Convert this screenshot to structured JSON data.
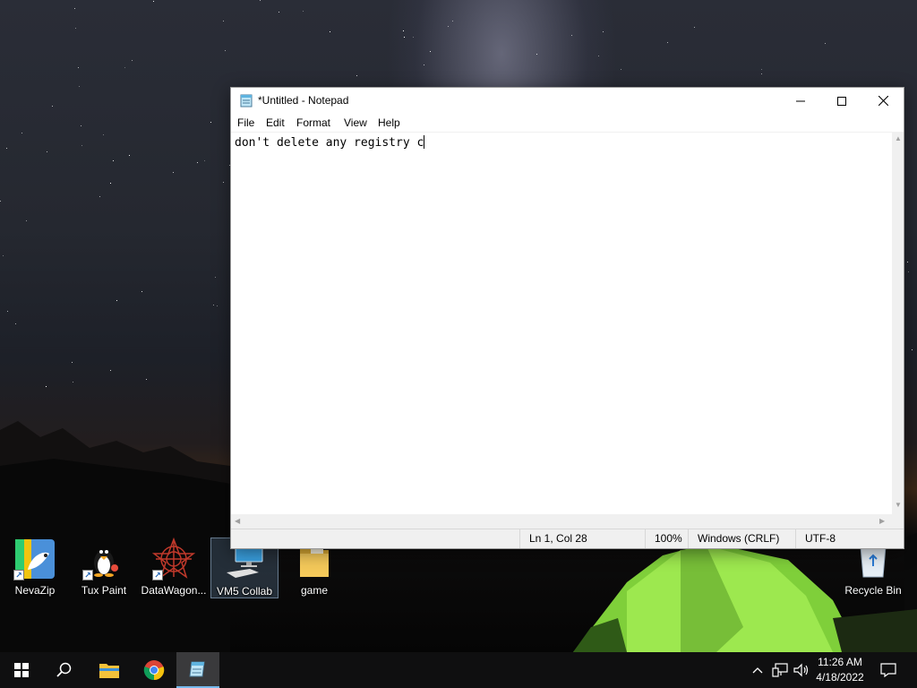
{
  "desktop": {
    "icons": [
      {
        "label": "NevaZip",
        "icon": "nevazip-icon"
      },
      {
        "label": "Tux Paint",
        "icon": "tux-paint-icon"
      },
      {
        "label": "DataWagon...",
        "icon": "datawagon-icon"
      },
      {
        "label": "VM5 Collab",
        "icon": "computer-icon"
      },
      {
        "label": "game",
        "icon": "folder-icon"
      },
      {
        "label": "Recycle Bin",
        "icon": "recycle-bin-icon"
      }
    ]
  },
  "notepad": {
    "title": "*Untitled - Notepad",
    "menu": [
      "File",
      "Edit",
      "Format",
      "View",
      "Help"
    ],
    "content": "don't delete any registry c",
    "status": {
      "position": "Ln 1, Col 28",
      "zoom": "100%",
      "line_ending": "Windows (CRLF)",
      "encoding": "UTF-8"
    }
  },
  "taskbar": {
    "clock_time": "11:26 AM",
    "clock_date": "4/18/2022"
  },
  "colors": {
    "accent": "#76b9ed",
    "taskbar": "#0f0f10",
    "tent_green": "#9be84a"
  }
}
